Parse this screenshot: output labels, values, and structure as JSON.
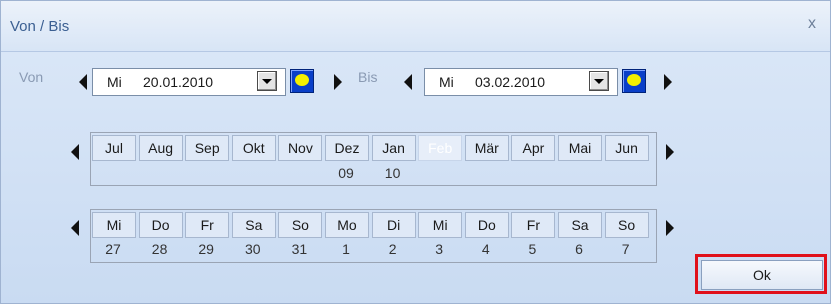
{
  "dialog": {
    "title": "Von / Bis",
    "close_glyph": "x"
  },
  "range": {
    "from_label": "Von",
    "from_dow": "Mi",
    "from_date": "20.01.2010",
    "to_label": "Bis",
    "to_dow": "Mi",
    "to_date": "03.02.2010"
  },
  "months": {
    "labels": [
      "Jul",
      "Aug",
      "Sep",
      "Okt",
      "Nov",
      "Dez",
      "Jan",
      "Feb",
      "Mär",
      "Apr",
      "Mai",
      "Jun"
    ],
    "disabled_index": 7,
    "year_labels": {
      "5": "09",
      "6": "10"
    }
  },
  "days": {
    "weekdays": [
      "Mi",
      "Do",
      "Fr",
      "Sa",
      "So",
      "Mo",
      "Di",
      "Mi",
      "Do",
      "Fr",
      "Sa",
      "So"
    ],
    "numbers": [
      "27",
      "28",
      "29",
      "30",
      "31",
      "1",
      "2",
      "3",
      "4",
      "5",
      "6",
      "7"
    ]
  },
  "buttons": {
    "ok": "Ok"
  },
  "icons": {
    "close": "close-icon",
    "prev": "triangle-left-icon",
    "next": "triangle-right-icon",
    "dropdown": "chevron-down-icon",
    "calendar": "calendar-picker-icon"
  },
  "colors": {
    "highlight": "#e0101a",
    "dialog_bg": "#d3e1f4",
    "title_text": "#3b5f92"
  }
}
